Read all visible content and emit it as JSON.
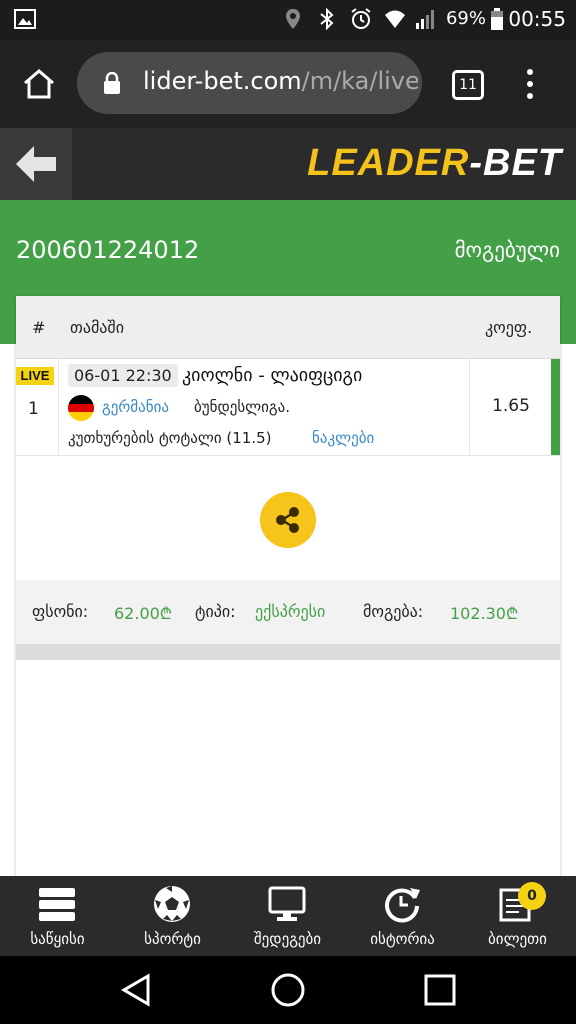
{
  "status_bar": {
    "time": "00:55",
    "battery": "69%"
  },
  "browser": {
    "url_host": "lider-bet.com",
    "url_path": "/m/ka/live",
    "tab_count": "11"
  },
  "site": {
    "logo_part1": "LEADER",
    "logo_part2": "-BET"
  },
  "ticket": {
    "id": "200601224012",
    "status": "მოგებული"
  },
  "table": {
    "headers": {
      "index": "#",
      "game": "თამაში",
      "odds": "კოეფ."
    },
    "rows": [
      {
        "live_label": "LIVE",
        "number": "1",
        "datetime": "06-01 22:30",
        "teams": "კიოლნი - ლაიფციგი",
        "country": "გერმანია",
        "league": "ბუნდესლიგა.",
        "market": "კუთხურების ტოტალი (11.5)",
        "selection": "ნაკლები",
        "odds": "1.65"
      }
    ]
  },
  "summary": {
    "stake_label": "ფსონი:",
    "stake_value": "62.00₾",
    "type_label": "ტიპი:",
    "type_value": "ექსპრესი",
    "win_label": "მოგება:",
    "win_value": "102.30₾"
  },
  "bottom_nav": [
    {
      "label": "საწყისი",
      "icon": "home-stack-icon"
    },
    {
      "label": "სპორტი",
      "icon": "soccer-ball-icon"
    },
    {
      "label": "შედეგები",
      "icon": "monitor-icon"
    },
    {
      "label": "ისტორია",
      "icon": "history-icon"
    },
    {
      "label": "ბილეთი",
      "icon": "ticket-icon"
    }
  ],
  "bet_count": "0",
  "colors": {
    "green": "#43a047",
    "yellow": "#f6c41a",
    "link_blue": "#3a87c8",
    "dark": "#2b2b2b"
  }
}
